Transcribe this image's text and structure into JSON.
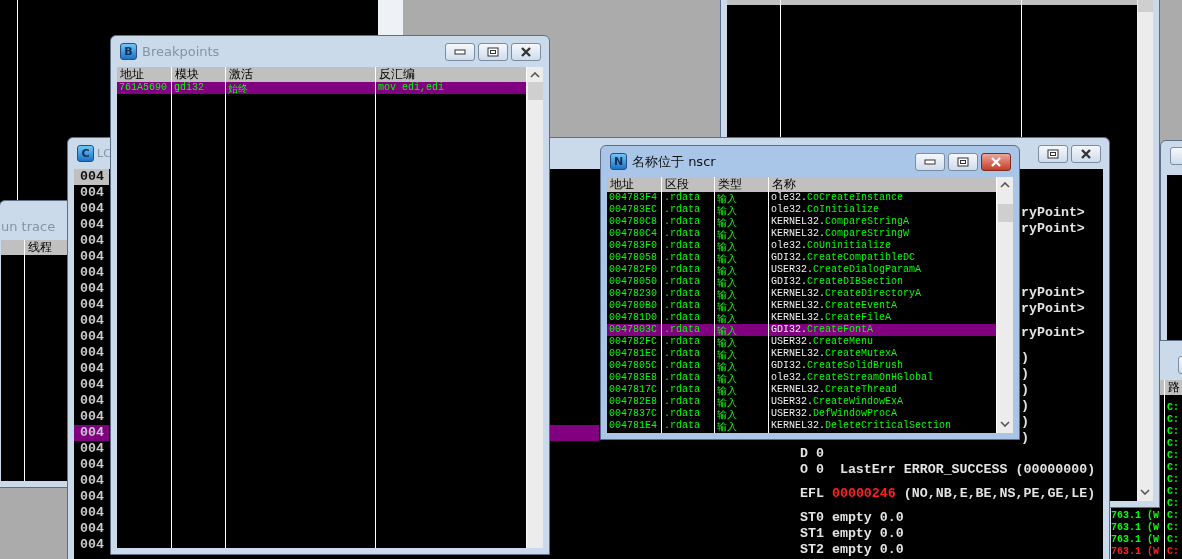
{
  "run_trace_window": {
    "title": "un trace",
    "columns": [
      "线程"
    ]
  },
  "cpu_window": {
    "title": "LC",
    "icon_letter": "C",
    "address_rows": [
      {
        "text": "004",
        "current": true,
        "selected": false
      },
      {
        "text": "004",
        "current": false,
        "selected": false
      },
      {
        "text": "004",
        "current": false,
        "selected": false
      },
      {
        "text": "004",
        "current": false,
        "selected": false
      },
      {
        "text": "004",
        "current": false,
        "selected": false
      },
      {
        "text": "004",
        "current": false,
        "selected": false
      },
      {
        "text": "004",
        "current": false,
        "selected": false
      },
      {
        "text": "004",
        "current": false,
        "selected": false
      },
      {
        "text": "004",
        "current": false,
        "selected": false
      },
      {
        "text": "004",
        "current": false,
        "selected": false
      },
      {
        "text": "004",
        "current": false,
        "selected": false
      },
      {
        "text": "004",
        "current": false,
        "selected": false
      },
      {
        "text": "004",
        "current": false,
        "selected": false
      },
      {
        "text": "004",
        "current": false,
        "selected": false
      },
      {
        "text": "004",
        "current": false,
        "selected": false
      },
      {
        "text": "004",
        "current": false,
        "selected": false
      },
      {
        "text": "004",
        "current": false,
        "selected": true
      },
      {
        "text": "004",
        "current": false,
        "selected": false
      },
      {
        "text": "004",
        "current": false,
        "selected": false
      },
      {
        "text": "004",
        "current": false,
        "selected": false
      },
      {
        "text": "004",
        "current": false,
        "selected": false
      },
      {
        "text": "004",
        "current": false,
        "selected": false
      },
      {
        "text": "004",
        "current": false,
        "selected": false
      },
      {
        "text": "004",
        "current": false,
        "selected": false
      }
    ],
    "registers": [
      {
        "kind": "tail",
        "text": "ryPoint>"
      },
      {
        "kind": "tail",
        "text": "ryPoint>"
      },
      {
        "kind": "tail",
        "text": "ryPoint>"
      },
      {
        "kind": "tail",
        "text": "ryPoint>"
      },
      {
        "kind": "tail",
        "text": "ryPoint>"
      },
      {
        "kind": "tail",
        "text": ")"
      },
      {
        "kind": "tail",
        "text": ")"
      },
      {
        "kind": "tail",
        "text": ")"
      },
      {
        "kind": "tail",
        "text": ")"
      },
      {
        "kind": "tail",
        "text": ")"
      },
      {
        "kind": "tail",
        "text": ")"
      },
      {
        "kind": "line",
        "text": "D 0"
      },
      {
        "kind": "line",
        "text": "O 0  LastErr ERROR_SUCCESS (00000000)"
      },
      {
        "kind": "flags",
        "label": "EFL",
        "value": "00000246",
        "text": "(NO,NB,E,BE,NS,PE,GE,LE)"
      },
      {
        "kind": "line",
        "text": "ST0 empty 0.0"
      },
      {
        "kind": "line",
        "text": "ST1 empty 0.0"
      },
      {
        "kind": "line",
        "text": "ST2 empty 0.0"
      }
    ]
  },
  "breakpoints_window": {
    "title": "Breakpoints",
    "icon_letter": "B",
    "columns": [
      "地址",
      "模块",
      "激活",
      "反汇编"
    ],
    "rows": [
      {
        "address": "761A5690",
        "module": "gdi32",
        "active": "始终",
        "disassembly": "mov edi,edi",
        "selected": true
      }
    ]
  },
  "names_window": {
    "title": "名称位于 nscr",
    "icon_letter": "N",
    "columns": [
      "地址",
      "区段",
      "类型",
      "名称"
    ],
    "rows": [
      {
        "address": "004783F4",
        "section": ".rdata",
        "type": "输入",
        "module": "ole32.",
        "function": "CoCreateInstance",
        "selected": false
      },
      {
        "address": "004783EC",
        "section": ".rdata",
        "type": "输入",
        "module": "ole32.",
        "function": "CoInitialize",
        "selected": false
      },
      {
        "address": "004780C8",
        "section": ".rdata",
        "type": "输入",
        "module": "KERNEL32.",
        "function": "CompareStringA",
        "selected": false
      },
      {
        "address": "004780C4",
        "section": ".rdata",
        "type": "输入",
        "module": "KERNEL32.",
        "function": "CompareStringW",
        "selected": false
      },
      {
        "address": "004783F0",
        "section": ".rdata",
        "type": "输入",
        "module": "ole32.",
        "function": "CoUninitialize",
        "selected": false
      },
      {
        "address": "00478058",
        "section": ".rdata",
        "type": "输入",
        "module": "GDI32.",
        "function": "CreateCompatibleDC",
        "selected": false
      },
      {
        "address": "004782F0",
        "section": ".rdata",
        "type": "输入",
        "module": "USER32.",
        "function": "CreateDialogParamA",
        "selected": false
      },
      {
        "address": "00478050",
        "section": ".rdata",
        "type": "输入",
        "module": "GDI32.",
        "function": "CreateDIBSection",
        "selected": false
      },
      {
        "address": "00478230",
        "section": ".rdata",
        "type": "输入",
        "module": "KERNEL32.",
        "function": "CreateDirectoryA",
        "selected": false
      },
      {
        "address": "004780B0",
        "section": ".rdata",
        "type": "输入",
        "module": "KERNEL32.",
        "function": "CreateEventA",
        "selected": false
      },
      {
        "address": "004781D0",
        "section": ".rdata",
        "type": "输入",
        "module": "KERNEL32.",
        "function": "CreateFileA",
        "selected": false
      },
      {
        "address": "0047803C",
        "section": ".rdata",
        "type": "输入",
        "module": "GDI32.",
        "function": "CreateFontA",
        "selected": true
      },
      {
        "address": "004782FC",
        "section": ".rdata",
        "type": "输入",
        "module": "USER32.",
        "function": "CreateMenu",
        "selected": false
      },
      {
        "address": "004781EC",
        "section": ".rdata",
        "type": "输入",
        "module": "KERNEL32.",
        "function": "CreateMutexA",
        "selected": false
      },
      {
        "address": "0047805C",
        "section": ".rdata",
        "type": "输入",
        "module": "GDI32.",
        "function": "CreateSolidBrush",
        "selected": false
      },
      {
        "address": "004783E8",
        "section": ".rdata",
        "type": "输入",
        "module": "ole32.",
        "function": "CreateStreamOnHGlobal",
        "selected": false
      },
      {
        "address": "0047817C",
        "section": ".rdata",
        "type": "输入",
        "module": "KERNEL32.",
        "function": "CreateThread",
        "selected": false
      },
      {
        "address": "004782E8",
        "section": ".rdata",
        "type": "输入",
        "module": "USER32.",
        "function": "CreateWindowExA",
        "selected": false
      },
      {
        "address": "0047837C",
        "section": ".rdata",
        "type": "输入",
        "module": "USER32.",
        "function": "DefWindowProcA",
        "selected": false
      },
      {
        "address": "004781E4",
        "section": ".rdata",
        "type": "输入",
        "module": "KERNEL32.",
        "function": "DeleteCriticalSection",
        "selected": false
      }
    ]
  },
  "log_window": {
    "columns": [
      "路"
    ],
    "rows": [
      {
        "path": "C:",
        "color": "#00ff00"
      },
      {
        "path": "C:",
        "color": "#00ff00"
      },
      {
        "path": "C:",
        "color": "#00ff00"
      },
      {
        "path": "C:",
        "color": "#00ff00"
      },
      {
        "path": "C:",
        "color": "#00ff00"
      },
      {
        "path": "C:",
        "color": "#00ff00"
      },
      {
        "path": "C:",
        "color": "#00ff00"
      },
      {
        "path": "C:",
        "color": "#00ff00"
      },
      {
        "path": "C:",
        "color": "#00ff00"
      },
      {
        "value": "763.1 (W",
        "path": "C:",
        "color": "#00ff00"
      },
      {
        "value": "763.1 (W",
        "path": "C:",
        "color": "#00ff00"
      },
      {
        "value": "763.1 (W",
        "path": "C:",
        "color": "#00ff00"
      },
      {
        "value": "763.1 (W",
        "path": "C:",
        "color": "#ff2020"
      }
    ]
  }
}
